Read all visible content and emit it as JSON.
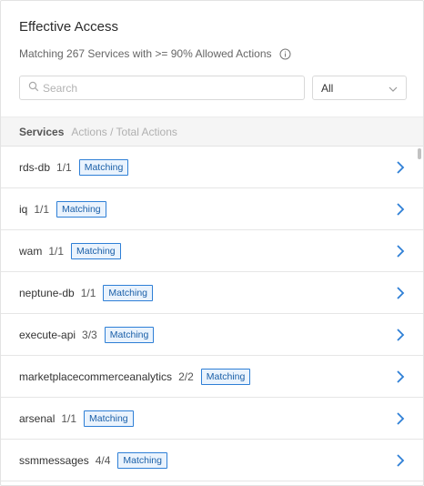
{
  "panel": {
    "title": "Effective Access",
    "subtitle": "Matching 267 Services with >= 90% Allowed Actions"
  },
  "search": {
    "placeholder": "Search",
    "value": ""
  },
  "filter": {
    "selected": "All"
  },
  "header": {
    "services_label": "Services",
    "actions_label": "Actions / Total Actions"
  },
  "rows": [
    {
      "name": "rds-db",
      "count": "1/1",
      "badge": "Matching"
    },
    {
      "name": "iq",
      "count": "1/1",
      "badge": "Matching"
    },
    {
      "name": "wam",
      "count": "1/1",
      "badge": "Matching"
    },
    {
      "name": "neptune-db",
      "count": "1/1",
      "badge": "Matching"
    },
    {
      "name": "execute-api",
      "count": "3/3",
      "badge": "Matching"
    },
    {
      "name": "marketplacecommerceanalytics",
      "count": "2/2",
      "badge": "Matching"
    },
    {
      "name": "arsenal",
      "count": "1/1",
      "badge": "Matching"
    },
    {
      "name": "ssmmessages",
      "count": "4/4",
      "badge": "Matching"
    }
  ],
  "colors": {
    "accent": "#2e7fd6",
    "badge_bg": "#eaf3fd",
    "header_bg": "#f5f5f5"
  },
  "icons": {
    "info": "info-icon",
    "search": "search-icon",
    "dropdown": "chevron-down-icon",
    "row_action": "chevron-right-icon"
  }
}
